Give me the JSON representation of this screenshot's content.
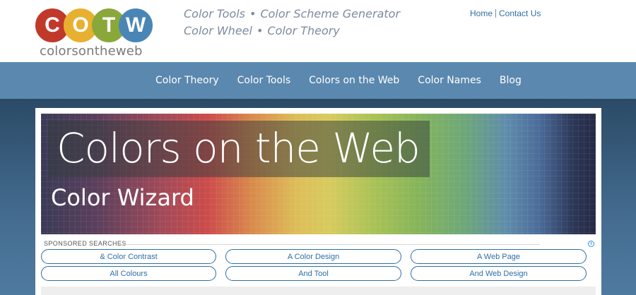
{
  "logo": {
    "letters": [
      "C",
      "O",
      "T",
      "W"
    ],
    "wordmark": "colorsontheweb",
    "colors": [
      "#c0392b",
      "#e8b030",
      "#8aa83a",
      "#4a86b5"
    ]
  },
  "tagline": {
    "row1": [
      "Color Tools",
      "Color Scheme Generator"
    ],
    "row2": [
      "Color Wheel",
      "Color Theory"
    ],
    "bullet": "•"
  },
  "top_links": [
    "Home",
    "Contact Us"
  ],
  "nav": [
    "Color Theory",
    "Color Tools",
    "Colors on the Web",
    "Color Names",
    "Blog"
  ],
  "hero": {
    "title": "Colors on the Web",
    "subtitle": "Color Wizard"
  },
  "sponsored": {
    "label": "SPONSORED SEARCHES",
    "ad_icon": "info-icon",
    "links": [
      [
        "& Color Contrast",
        "A Color Design",
        "A Web Page"
      ],
      [
        "All Colours",
        "And Tool",
        "And Web Design"
      ]
    ]
  },
  "colors": {
    "nav_bg": "#5b88ae",
    "link": "#2f6ea5",
    "tagline": "#7d8ba0"
  }
}
